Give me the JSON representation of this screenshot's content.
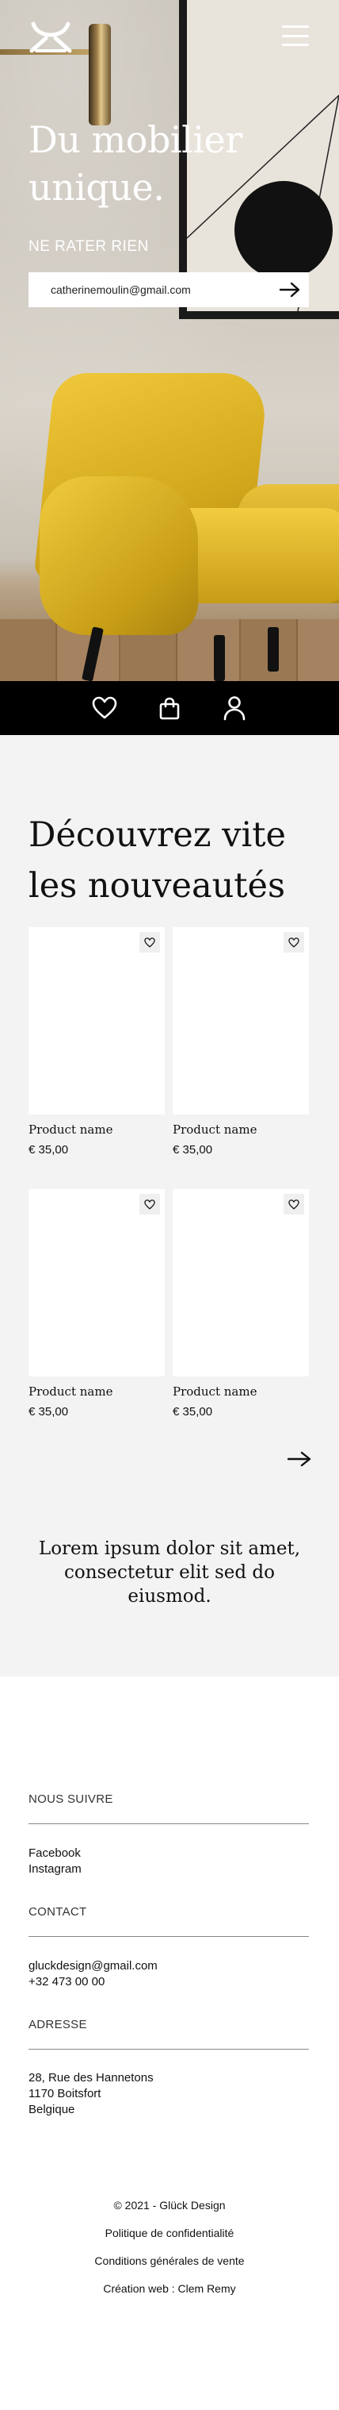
{
  "hero": {
    "title": "Du mobilier unique.",
    "newsletter_label": "NE RATER RIEN",
    "email_value": "catherinemoulin@gmail.com"
  },
  "icons": {
    "logo": "brand-logo",
    "menu": "hamburger-menu-icon",
    "submit": "arrow-right-icon",
    "tabs": [
      "heart-icon",
      "shopping-bag-icon",
      "user-icon"
    ]
  },
  "arrivals": {
    "title": "Découvrez vite les nouveautés",
    "products": [
      {
        "name": "Product name",
        "price": "€ 35,00"
      },
      {
        "name": "Product name",
        "price": "€ 35,00"
      },
      {
        "name": "Product name",
        "price": "€ 35,00"
      },
      {
        "name": "Product name",
        "price": "€ 35,00"
      }
    ],
    "quote": "Lorem ipsum dolor sit amet, consectetur elit sed do eiusmod."
  },
  "footer": {
    "follow": {
      "heading": "NOUS SUIVRE",
      "links": [
        "Facebook",
        "Instagram"
      ]
    },
    "contact": {
      "heading": "CONTACT",
      "email": "gluckdesign@gmail.com",
      "phone": "+32 473 00 00"
    },
    "address": {
      "heading": "ADRESSE",
      "lines": [
        "28, Rue des Hannetons",
        "1170 Boitsfort",
        "Belgique"
      ]
    },
    "copyright": "© 2021 - Glück Design",
    "privacy": "Politique de confidentialité",
    "terms": "Conditions générales de vente",
    "credits": "Création web : Clem Remy"
  },
  "colors": {
    "accent": "#e2b92a",
    "bar": "#000000",
    "section_bg": "#f3f3f3"
  }
}
